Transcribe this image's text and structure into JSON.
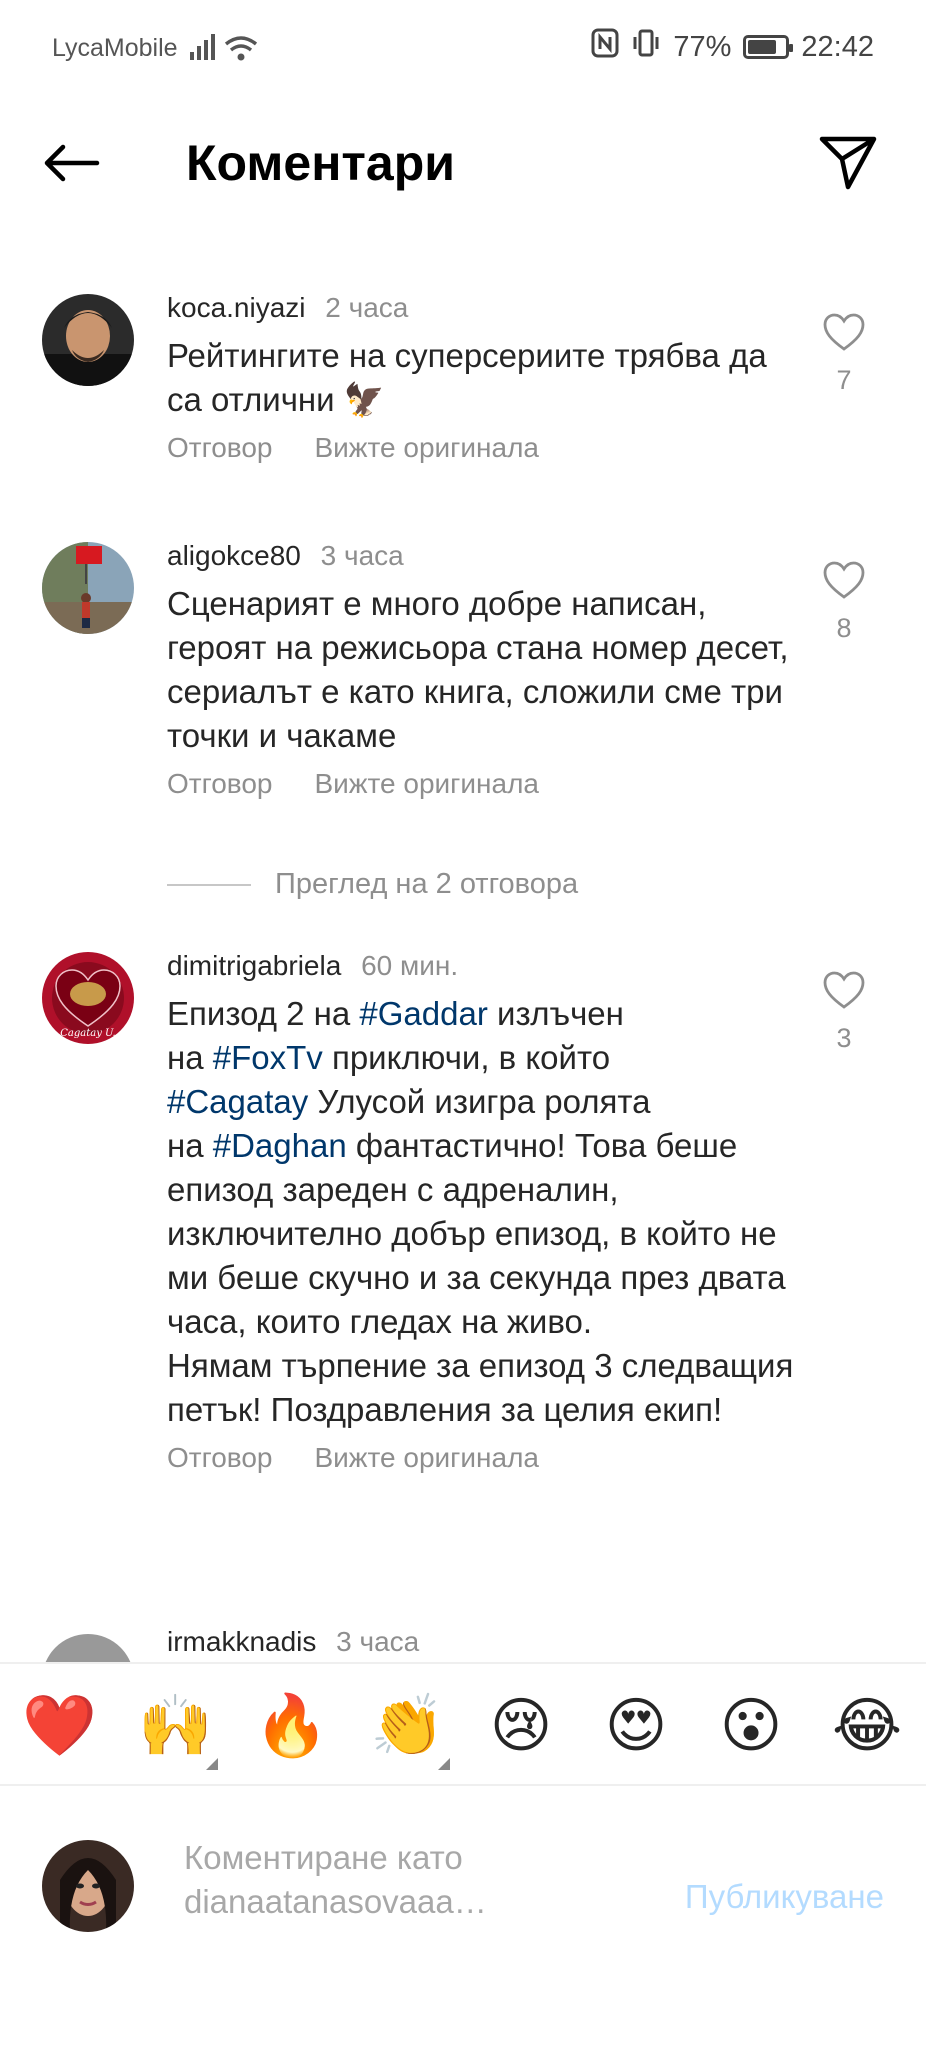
{
  "status_bar": {
    "carrier": "LycaMobile",
    "battery": "77%",
    "battery_fraction": 0.77,
    "time": "22:42"
  },
  "header": {
    "title": "Коментари"
  },
  "comments": [
    {
      "username": "koca.niyazi",
      "time": "2 часа",
      "text": "Рейтингите на суперсериите трябва да са отлични 🦅",
      "likes": "7",
      "reply": "Отговор",
      "see_original": "Вижте оригинала"
    },
    {
      "username": "aligokce80",
      "time": "3 часа",
      "text": "Сценарият е много добре написан, героят на режисьора стана номер десет, сериалът е като книга, сложили сме три точки и чакаме",
      "likes": "8",
      "reply": "Отговор",
      "see_original": "Вижте оригинала"
    },
    {
      "username": "dimitrigabriela",
      "time": "60 мин.",
      "text_parts": [
        "Епизод 2 на ",
        "#Gaddar",
        " излъчен\nна ",
        "#FoxTv",
        " приключи, в който\n",
        "#Cagatay",
        " Улусой изигра ролята\nна ",
        "#Daghan",
        " фантастично! Това беше епизод зареден с адреналин, изключително добър епизод, в който не ми беше скучно и за секунда през двата часа, които гледах на живо.\nНямам търпение за епизод 3 следващия петък! Поздравления за целия екип!"
      ],
      "likes": "3",
      "reply": "Отговор",
      "see_original": "Вижте оригинала"
    },
    {
      "username": "irmakknadis",
      "time": "3 часа"
    }
  ],
  "view_replies": "Преглед на 2 отговора",
  "emoji_bar": [
    "❤️",
    "🙌",
    "🔥",
    "👏",
    "😢",
    "😍",
    "😮",
    "😂"
  ],
  "input": {
    "placeholder": "Коментиране като dianaatanasovaaa…",
    "post_label": "Публикуване"
  },
  "colors": {
    "hashtag": "#00376b",
    "secondary_text": "#8e8e8e",
    "post_button": "#b3dbff"
  }
}
